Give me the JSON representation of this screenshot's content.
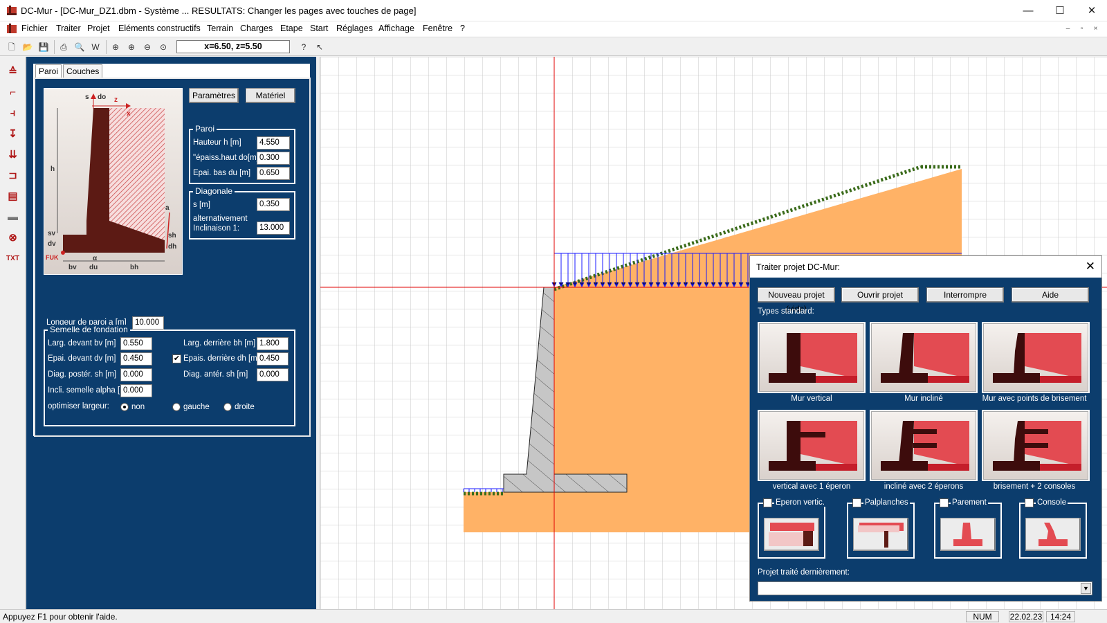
{
  "window": {
    "title": "DC-Mur - [DC-Mur_DZ1.dbm - Système ... RESULTATS: Changer les pages avec touches de page]",
    "min": "—",
    "max": "☐",
    "close": "✕"
  },
  "menu": [
    "Fichier",
    "Traiter",
    "Projet",
    "Eléments constructifs",
    "Terrain",
    "Charges",
    "Etape",
    "Start",
    "Réglages",
    "Affichage",
    "Fenêtre",
    "?"
  ],
  "mdi": {
    "min": "–",
    "restore": "▫",
    "close": "×"
  },
  "toolbar": {
    "coord": "x=6.50, z=5.50"
  },
  "panel": {
    "tabs": [
      "Paroi",
      "Couches"
    ],
    "sketch": {
      "s": "s",
      "do": "do",
      "z": "z",
      "x": "x",
      "h": "h",
      "sv": "sv",
      "dv": "dv",
      "fuk": "FUK",
      "bv": "bv",
      "alpha": "α",
      "du": "du",
      "bh": "bh",
      "a": "a",
      "sh": "sh",
      "dh": "dh"
    },
    "btn_params": "Paramètres",
    "btn_material": "Matériel",
    "paroi": {
      "title": "Paroi",
      "h_label": "Hauteur h [m]",
      "h": "4.550",
      "do_label": "\"épaiss.haut do[m]",
      "do": "0.300",
      "du_label": "Epai. bas du [m]",
      "du": "0.650"
    },
    "diag": {
      "title": "Diagonale",
      "s_label": "s [m]",
      "s": "0.350",
      "alt_label1": "alternativement",
      "alt_label2": "Inclinaison 1:",
      "incl": "13.000"
    },
    "length_label": "Longeur de paroi a [m]",
    "length": "10.000",
    "semelle": {
      "title": "Semelle de fondation",
      "bv_label": "Larg. devant bv [m]",
      "bv": "0.550",
      "bh_label": "Larg. derrière bh [m]",
      "bh": "1.800",
      "dv_label": "Epai. devant dv [m]",
      "dv": "0.450",
      "dh_label": "Epais. derrière dh [m]",
      "dh": "0.450",
      "shpost_label": "Diag. postér. sh [m]",
      "shpost": "0.000",
      "shant_label": "Diag. antér. sh [m]",
      "shant": "0.000",
      "alpha_label": "Incli. semelle alpha [°]",
      "alpha": "0.000",
      "opt_label": "optimiser largeur:",
      "opt": [
        "non",
        "gauche",
        "droite"
      ]
    }
  },
  "dialog": {
    "title": "Traiter projet DC-Mur:",
    "close": "✕",
    "buttons": [
      "Nouveau projet (vide)",
      "Ouvrir projet",
      "Interrompre",
      "Aide"
    ],
    "types_label": "Types standard:",
    "types": [
      "Mur vertical",
      "Mur incliné",
      "Mur avec points de brisement",
      "vertical avec 1 éperon",
      "incliné avec 2 éperons",
      "brisement + 2 consoles"
    ],
    "special": [
      "Eperon vertic.",
      "Palplanches",
      "Parement",
      "Console"
    ],
    "last_label": "Projet traité dernièrement:",
    "last_value": ""
  },
  "status": {
    "help": "Appuyez F1 pour obtenir l'aide.",
    "num": "NUM",
    "date": "22.02.23",
    "time": "14:24"
  },
  "colors": {
    "panel": "#0c3d6d",
    "soil": "#ffb266",
    "wall": "#5c1a14",
    "load": "#1a1aff",
    "axis": "#e00000"
  }
}
